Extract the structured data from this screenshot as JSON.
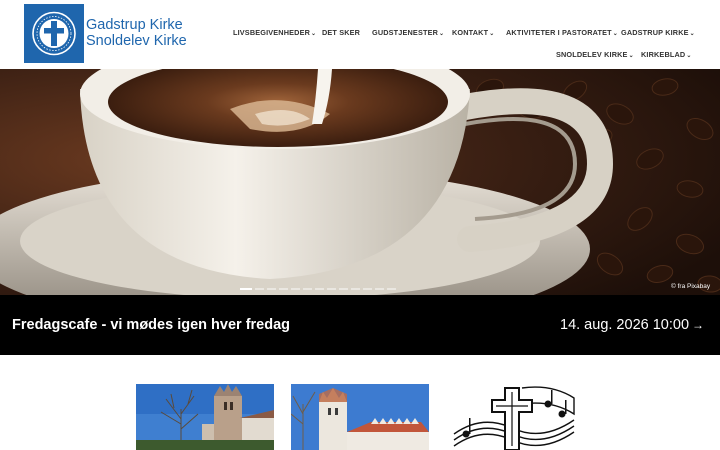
{
  "site": {
    "name_line1": "Gadstrup Kirke",
    "name_line2": "Snoldelev Kirke"
  },
  "nav": {
    "items": [
      {
        "label": "LIVSBEGIVENHEDER",
        "has_dropdown": true
      },
      {
        "label": "DET SKER",
        "has_dropdown": false
      },
      {
        "label": "GUDSTJENESTER",
        "has_dropdown": true
      },
      {
        "label": "KONTAKT",
        "has_dropdown": true
      },
      {
        "label": "AKTIVITETER I PASTORATET",
        "has_dropdown": true
      },
      {
        "label": "GADSTRUP KIRKE",
        "has_dropdown": true
      },
      {
        "label": "SNOLDELEV KIRKE",
        "has_dropdown": true
      },
      {
        "label": "KIRKEBLAD",
        "has_dropdown": true
      }
    ],
    "chevron": "⌄"
  },
  "hero": {
    "image": "coffee-cup-with-milk-pour",
    "credit": "© fra Pixabay",
    "slides_total": 13,
    "active_slide": 1
  },
  "event": {
    "title": "Fredagscafe - vi mødes igen hver fredag",
    "date": "14. aug. 2026 10:00",
    "arrow": "→"
  },
  "cards": [
    {
      "image": "gadstrup-church-photo"
    },
    {
      "image": "snoldelev-church-photo"
    },
    {
      "image": "cross-and-music-notes-drawing"
    }
  ],
  "colors": {
    "brand_blue": "#1f66ad",
    "event_bar": "#000000",
    "nav_text": "#333333"
  }
}
